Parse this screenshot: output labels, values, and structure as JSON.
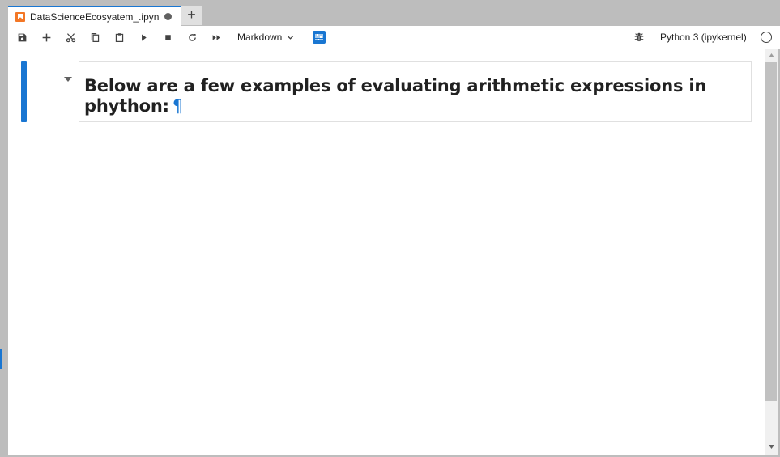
{
  "tabs": [
    {
      "title": "DataScienceEcosyatem_.ipyn",
      "dirty": true,
      "active": true
    }
  ],
  "tab_add_label": "+",
  "toolbar": {
    "buttons": [
      {
        "name": "save-icon"
      },
      {
        "name": "insert-cell-icon"
      },
      {
        "name": "cut-icon"
      },
      {
        "name": "copy-icon"
      },
      {
        "name": "paste-icon"
      },
      {
        "name": "run-icon"
      },
      {
        "name": "interrupt-icon"
      },
      {
        "name": "restart-icon"
      },
      {
        "name": "restart-run-all-icon"
      }
    ],
    "cell_type": "Markdown",
    "kernel_name": "Python 3 (ipykernel)"
  },
  "notebook": {
    "cells": [
      {
        "type": "markdown",
        "heading": "Below are a few examples of evaluating arithmetic expressions in phython:",
        "anchor": "¶"
      }
    ]
  },
  "colors": {
    "accent": "#1976d2",
    "tab_icon": "#f37726"
  }
}
